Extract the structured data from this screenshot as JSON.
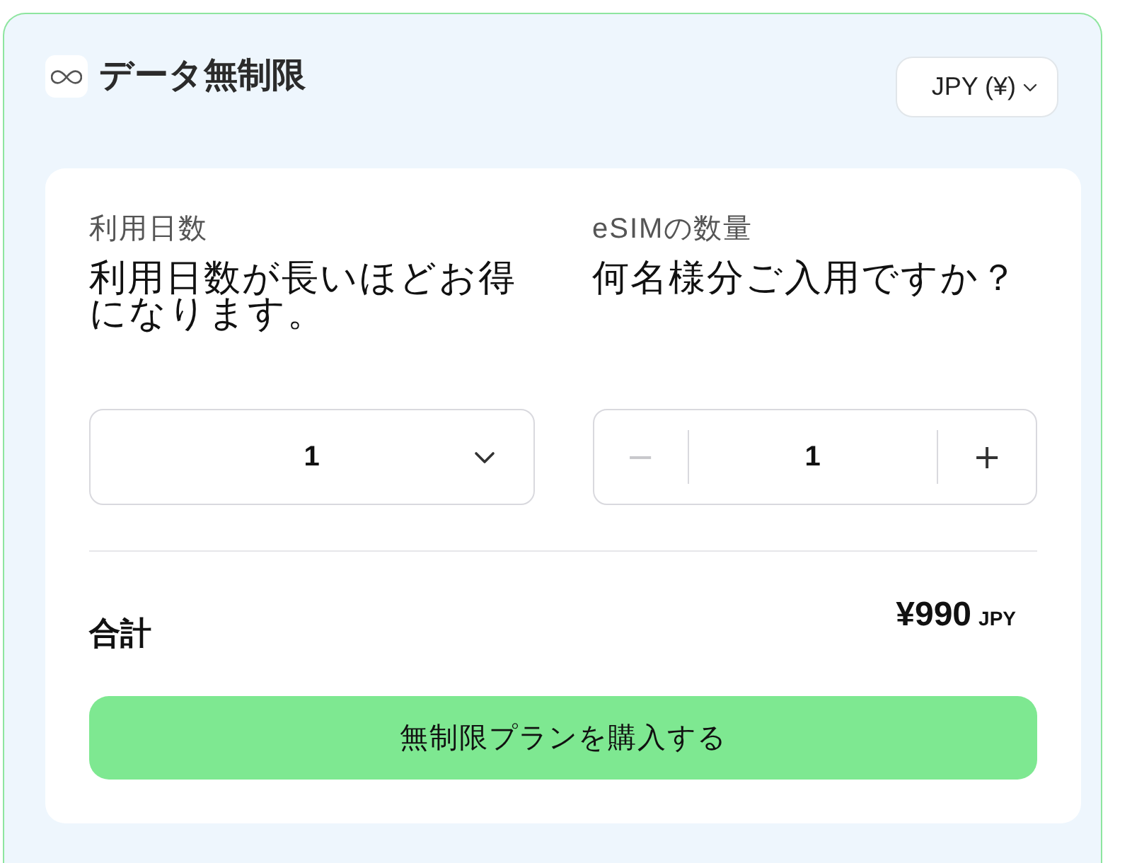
{
  "header": {
    "title": "データ無制限",
    "currency": "JPY (¥)"
  },
  "fields": [
    {
      "kind": "select",
      "label": "利用日数",
      "description": "利用日数が長いほどお得になります。",
      "value": "1"
    },
    {
      "kind": "stepper",
      "label": "eSIMの数量",
      "description": "何名様分ご入用ですか？",
      "value": "1",
      "decrement": {
        "symbol": "−",
        "disabled": true
      },
      "increment": {
        "symbol": "+",
        "disabled": false
      }
    }
  ],
  "total": {
    "label": "合計",
    "amount": "¥990",
    "currency": "JPY"
  },
  "buy_button": "無制限プランを購入する"
}
